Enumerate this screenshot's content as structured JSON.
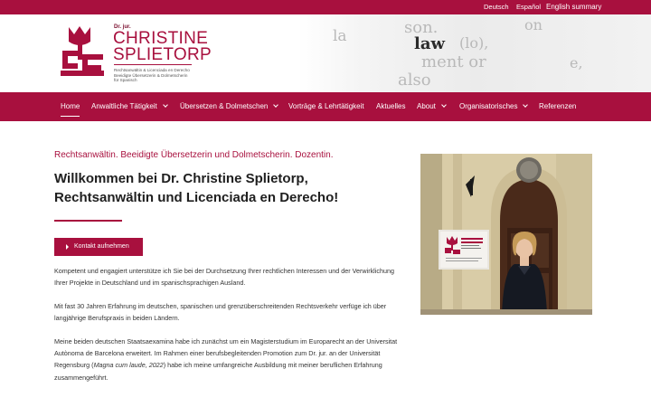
{
  "top_bar": {
    "languages": [
      "Deutsch",
      "Español"
    ],
    "summary_link": "English summary"
  },
  "logo": {
    "title_prefix": "Dr. jur.",
    "name_line1": "CHRISTINE",
    "name_line2": "SPLIETORP",
    "subtitle_lines": [
      "Rechtsanwältin & Licenciada en Derecho",
      "Beeidigte Übersetzerin & Dolmetscherin",
      "für Spanisch"
    ]
  },
  "header_image": {
    "words": [
      "son.",
      "la",
      "law",
      "(lo),",
      "ment or",
      "also",
      "on",
      "e,"
    ]
  },
  "nav": {
    "items": [
      {
        "label": "Home",
        "active": true,
        "dropdown": false
      },
      {
        "label": "Anwaltliche Tätigkeit",
        "active": false,
        "dropdown": true
      },
      {
        "label": "Übersetzen & Dolmetschen",
        "active": false,
        "dropdown": true
      },
      {
        "label": "Vorträge & Lehrtätigkeit",
        "active": false,
        "dropdown": false
      },
      {
        "label": "Aktuelles",
        "active": false,
        "dropdown": false
      },
      {
        "label": "About",
        "active": false,
        "dropdown": true
      },
      {
        "label": "Organisatorisches",
        "active": false,
        "dropdown": true
      },
      {
        "label": "Referenzen",
        "active": false,
        "dropdown": false
      }
    ]
  },
  "main": {
    "tagline": "Rechtsanwältin. Beeidigte Übersetzerin und Dolmetscherin. Dozentin.",
    "headline": "Willkommen bei Dr. Christine Splietorp, Rechtsanwältin und Licenciada en Derecho!",
    "contact_button": "Kontakt aufnehmen",
    "paragraph1": "Kompetent und engagiert unterstütze ich Sie bei der Durchsetzung Ihrer rechtlichen Interessen und der Verwirklichung Ihrer Projekte in Deutschland und im spanischsprachigen Ausland.",
    "paragraph2": "Mit fast 30 Jahren Erfahrung im deutschen, spanischen und grenzüberschreitenden Rechtsverkehr verfüge ich über langjährige Berufspraxis in beiden Ländern.",
    "paragraph3_before": "Meine beiden deutschen Staatsaexamina habe ich zunächst um ein Magisterstudium im Europarecht an der Universitat Autònoma de Barcelona erweitert. Im Rahmen einer berufsbegleitenden Promotion zum Dr. jur. an der Universität Regensburg (",
    "paragraph3_italic": "Magna cum laude, 2022",
    "paragraph3_after": ") habe ich meine umfangreiche Ausbildung mit meiner beruflichen Erfahrung zusammengeführt."
  },
  "colors": {
    "brand": "#a8103e",
    "text": "#333333",
    "heading": "#1f1f1f"
  },
  "icons": {
    "dropdown": "chevron-down-icon",
    "button": "play-arrow-icon"
  }
}
